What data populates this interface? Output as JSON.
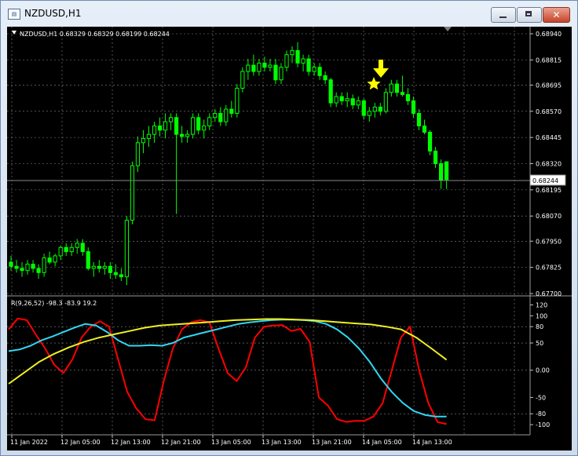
{
  "window": {
    "title": "NZDUSD,H1",
    "icon_name": "chart-window-icon",
    "minimize_icon": "minimize-icon",
    "maximize_icon": "maximize-icon",
    "close_icon": "close-icon"
  },
  "main_chart": {
    "info_label": "NZDUSD,H1  0.68329 0.68329 0.68199 0.68244",
    "current_price_label": "0.68244",
    "price_ticks": [
      "0.68940",
      "0.68815",
      "0.68695",
      "0.68570",
      "0.68445",
      "0.68320",
      "0.68195",
      "0.68070",
      "0.67950",
      "0.67825",
      "0.67700"
    ],
    "arrow_icon": "down-arrow-icon",
    "star_icon": "star-icon"
  },
  "indicator": {
    "label": "R(9,26,52) -98.3 -83.9 19.2",
    "ticks": [
      "120",
      "100",
      "80",
      "50",
      "0.00",
      "-50",
      "-80",
      "-100"
    ]
  },
  "time_axis": [
    "11 Jan 2022",
    "12 Jan 05:00",
    "12 Jan 13:00",
    "12 Jan 21:00",
    "13 Jan 05:00",
    "13 Jan 13:00",
    "13 Jan 21:00",
    "14 Jan 05:00",
    "14 Jan 13:00"
  ],
  "colors": {
    "background": "#000000",
    "candle": "#00ff00",
    "grid": "#c0c0c0",
    "red_line": "#ff0000",
    "cyan_line": "#33d6f2",
    "yellow_line": "#f0f020",
    "marker": "#ffff00"
  },
  "chart_data": {
    "type": "candlestick",
    "price_axis": {
      "min": 0.677,
      "max": 0.6894
    },
    "candles": [
      [
        0.6785,
        0.6788,
        0.6781,
        0.6783
      ],
      [
        0.6783,
        0.6786,
        0.678,
        0.6782
      ],
      [
        0.6782,
        0.6785,
        0.6778,
        0.6781
      ],
      [
        0.6781,
        0.6786,
        0.6779,
        0.6784
      ],
      [
        0.6784,
        0.6786,
        0.678,
        0.6782
      ],
      [
        0.6782,
        0.6784,
        0.6777,
        0.678
      ],
      [
        0.678,
        0.6789,
        0.6778,
        0.6787
      ],
      [
        0.6787,
        0.679,
        0.6784,
        0.6785
      ],
      [
        0.6785,
        0.6789,
        0.6783,
        0.6788
      ],
      [
        0.6788,
        0.6793,
        0.6786,
        0.6792
      ],
      [
        0.6792,
        0.6794,
        0.6788,
        0.679
      ],
      [
        0.679,
        0.6794,
        0.6788,
        0.6792
      ],
      [
        0.6792,
        0.6796,
        0.6789,
        0.6794
      ],
      [
        0.6794,
        0.6796,
        0.6788,
        0.679
      ],
      [
        0.679,
        0.6792,
        0.6781,
        0.6782
      ],
      [
        0.6782,
        0.6785,
        0.6778,
        0.6783
      ],
      [
        0.6783,
        0.6786,
        0.678,
        0.6782
      ],
      [
        0.6782,
        0.6785,
        0.6779,
        0.6783
      ],
      [
        0.6783,
        0.6785,
        0.6777,
        0.678
      ],
      [
        0.678,
        0.6784,
        0.6777,
        0.6779
      ],
      [
        0.6779,
        0.6782,
        0.6776,
        0.6778
      ],
      [
        0.6778,
        0.6807,
        0.6774,
        0.6805
      ],
      [
        0.6805,
        0.6833,
        0.6803,
        0.6831
      ],
      [
        0.6831,
        0.6845,
        0.6828,
        0.6842
      ],
      [
        0.6842,
        0.6848,
        0.6837,
        0.6844
      ],
      [
        0.6844,
        0.685,
        0.684,
        0.6846
      ],
      [
        0.6846,
        0.6852,
        0.6842,
        0.685
      ],
      [
        0.685,
        0.6854,
        0.6845,
        0.6848
      ],
      [
        0.6848,
        0.6856,
        0.6844,
        0.6852
      ],
      [
        0.6852,
        0.6856,
        0.6848,
        0.6854
      ],
      [
        0.6854,
        0.6856,
        0.6808,
        0.6846
      ],
      [
        0.6846,
        0.685,
        0.6842,
        0.6845
      ],
      [
        0.6845,
        0.6848,
        0.6842,
        0.6846
      ],
      [
        0.6846,
        0.6856,
        0.6844,
        0.6854
      ],
      [
        0.6854,
        0.6856,
        0.6846,
        0.6848
      ],
      [
        0.6848,
        0.6853,
        0.6844,
        0.685
      ],
      [
        0.685,
        0.6856,
        0.6848,
        0.6854
      ],
      [
        0.6854,
        0.6858,
        0.6852,
        0.6856
      ],
      [
        0.6856,
        0.6859,
        0.685,
        0.6852
      ],
      [
        0.6852,
        0.686,
        0.685,
        0.6858
      ],
      [
        0.6858,
        0.6862,
        0.6854,
        0.6856
      ],
      [
        0.6856,
        0.687,
        0.6854,
        0.6868
      ],
      [
        0.6868,
        0.6878,
        0.6866,
        0.6876
      ],
      [
        0.6876,
        0.6882,
        0.6872,
        0.6879
      ],
      [
        0.6879,
        0.6884,
        0.6874,
        0.6876
      ],
      [
        0.6876,
        0.6882,
        0.6874,
        0.688
      ],
      [
        0.688,
        0.6883,
        0.6876,
        0.6878
      ],
      [
        0.6878,
        0.6882,
        0.6876,
        0.6879
      ],
      [
        0.6879,
        0.6882,
        0.687,
        0.6872
      ],
      [
        0.6872,
        0.688,
        0.687,
        0.6878
      ],
      [
        0.6878,
        0.6886,
        0.6876,
        0.6884
      ],
      [
        0.6884,
        0.6888,
        0.688,
        0.6886
      ],
      [
        0.6886,
        0.689,
        0.6878,
        0.688
      ],
      [
        0.688,
        0.6884,
        0.6876,
        0.6882
      ],
      [
        0.6882,
        0.6884,
        0.6874,
        0.6876
      ],
      [
        0.6876,
        0.688,
        0.6874,
        0.6878
      ],
      [
        0.6878,
        0.688,
        0.6872,
        0.6874
      ],
      [
        0.6874,
        0.6876,
        0.687,
        0.6872
      ],
      [
        0.6872,
        0.6873,
        0.6859,
        0.6861
      ],
      [
        0.6861,
        0.6866,
        0.6859,
        0.6864
      ],
      [
        0.6864,
        0.6866,
        0.686,
        0.6862
      ],
      [
        0.6862,
        0.6866,
        0.6859,
        0.6863
      ],
      [
        0.6863,
        0.6865,
        0.6858,
        0.686
      ],
      [
        0.686,
        0.6864,
        0.6858,
        0.6862
      ],
      [
        0.6862,
        0.6863,
        0.6853,
        0.6855
      ],
      [
        0.6855,
        0.6859,
        0.6852,
        0.6857
      ],
      [
        0.6857,
        0.6861,
        0.6854,
        0.6859
      ],
      [
        0.6859,
        0.6861,
        0.6855,
        0.6857
      ],
      [
        0.6857,
        0.6868,
        0.6856,
        0.6866
      ],
      [
        0.6866,
        0.6872,
        0.6864,
        0.687
      ],
      [
        0.687,
        0.6872,
        0.6864,
        0.6866
      ],
      [
        0.6866,
        0.6874,
        0.6864,
        0.6865
      ],
      [
        0.6865,
        0.6868,
        0.686,
        0.6862
      ],
      [
        0.6862,
        0.6864,
        0.6854,
        0.6856
      ],
      [
        0.6856,
        0.6858,
        0.6848,
        0.685
      ],
      [
        0.685,
        0.6853,
        0.6846,
        0.6847
      ],
      [
        0.6847,
        0.6848,
        0.6836,
        0.6838
      ],
      [
        0.6838,
        0.684,
        0.683,
        0.6832
      ],
      [
        0.6832,
        0.6834,
        0.682,
        0.6824
      ],
      [
        0.68329,
        0.68329,
        0.68199,
        0.68244
      ]
    ],
    "indicator_axis": {
      "min": -110,
      "max": 125
    },
    "indicator_series": [
      {
        "color": "red",
        "values": [
          75,
          95,
          92,
          65,
          40,
          10,
          -5,
          20,
          60,
          80,
          90,
          80,
          20,
          -40,
          -70,
          -90,
          -92,
          -20,
          40,
          75,
          88,
          92,
          88,
          40,
          -5,
          -20,
          5,
          60,
          80,
          82,
          83,
          72,
          76,
          52,
          -50,
          -65,
          -90,
          -95,
          -93,
          -93,
          -85,
          -60,
          0,
          60,
          80,
          0,
          -60,
          -95,
          -99
        ]
      },
      {
        "color": "cyan",
        "values": [
          35,
          38,
          45,
          55,
          62,
          70,
          78,
          85,
          82,
          70,
          55,
          45,
          45,
          46,
          45,
          50,
          60,
          65,
          70,
          75,
          80,
          85,
          88,
          90,
          92,
          93,
          93,
          92,
          90,
          85,
          75,
          60,
          40,
          15,
          -15,
          -40,
          -60,
          -75,
          -82,
          -85,
          -85
        ]
      },
      {
        "color": "yellow",
        "values": [
          -25,
          -5,
          15,
          30,
          42,
          52,
          60,
          66,
          72,
          78,
          82,
          84,
          86,
          88,
          90,
          92,
          93,
          94,
          94,
          93,
          92,
          90,
          88,
          86,
          84,
          80,
          75,
          60,
          40,
          19.2
        ]
      }
    ]
  }
}
